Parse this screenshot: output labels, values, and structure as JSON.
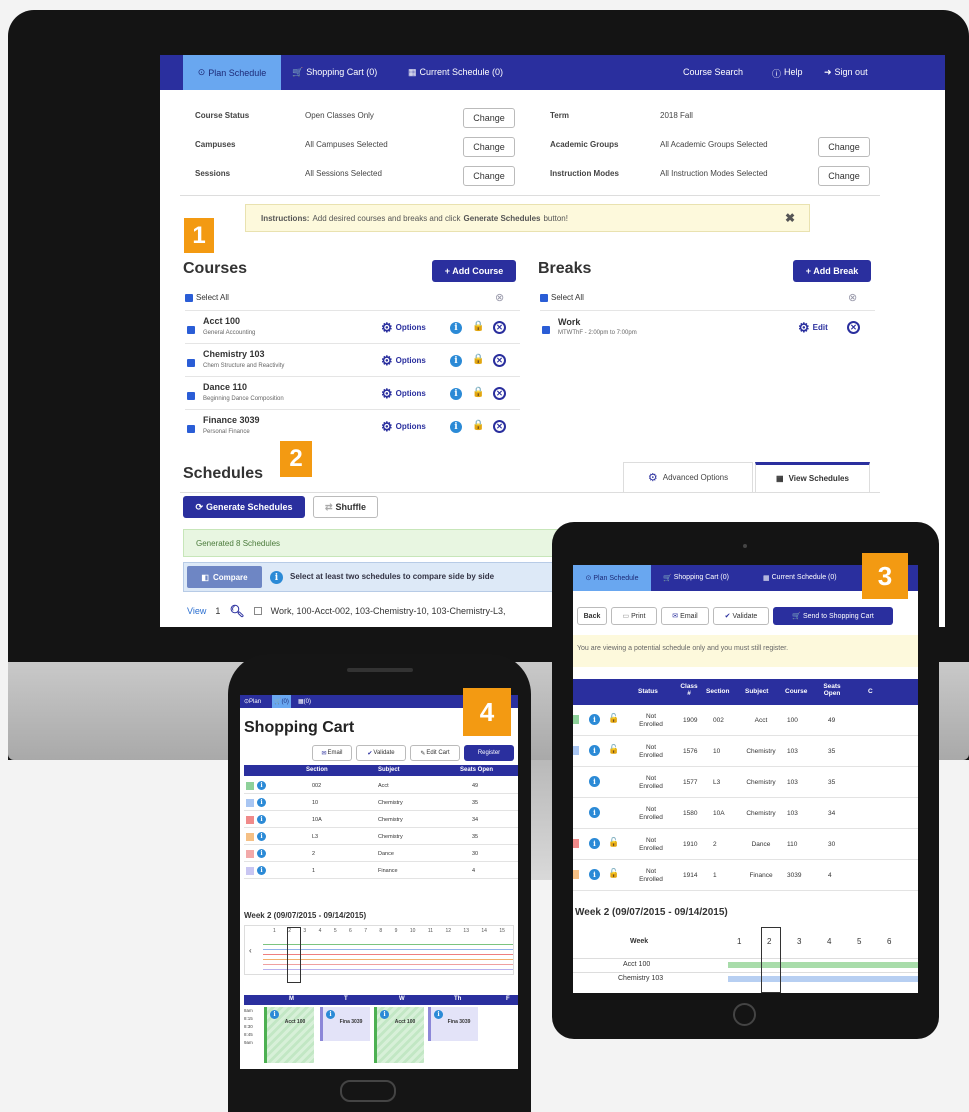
{
  "desktop": {
    "nav": {
      "plan": "Plan Schedule",
      "cart": "Shopping Cart (0)",
      "current": "Current Schedule (0)",
      "search": "Course Search",
      "help": "Help",
      "signout": "Sign out"
    },
    "filters": [
      {
        "label": "Course Status",
        "value": "Open Classes Only",
        "button": "Change"
      },
      {
        "label": "Campuses",
        "value": "All Campuses Selected",
        "button": "Change"
      },
      {
        "label": "Sessions",
        "value": "All Sessions Selected",
        "button": "Change"
      },
      {
        "label": "Term",
        "value": "2018 Fall"
      },
      {
        "label": "Academic Groups",
        "value": "All Academic Groups Selected",
        "button": "Change"
      },
      {
        "label": "Instruction Modes",
        "value": "All Instruction Modes Selected",
        "button": "Change"
      }
    ],
    "instructions": {
      "bold": "Instructions:",
      "text": "Add desired courses and breaks and click",
      "button_ref": "Generate Schedules",
      "tail": "button!"
    },
    "courses": {
      "title": "Courses",
      "add": "+ Add Course",
      "select_all": "Select All",
      "options_label": "Options",
      "items": [
        {
          "name": "Acct 100",
          "desc": "General Accounting"
        },
        {
          "name": "Chemistry 103",
          "desc": "Chem Structure and Reactivity"
        },
        {
          "name": "Dance 110",
          "desc": "Beginning Dance Composition"
        },
        {
          "name": "Finance 3039",
          "desc": "Personal Finance"
        }
      ]
    },
    "breaks": {
      "title": "Breaks",
      "add": "+ Add Break",
      "select_all": "Select All",
      "items": [
        {
          "name": "Work",
          "desc": "MTWThF - 2:00pm to 7:00pm",
          "edit": "Edit"
        }
      ]
    },
    "schedules": {
      "title": "Schedules",
      "advanced": "Advanced Options",
      "view": "View Schedules",
      "generate": "Generate Schedules",
      "shuffle": "Shuffle",
      "generated": "Generated 8 Schedules",
      "compare": "Compare",
      "compare_hint": "Select at least two schedules to compare side by side",
      "view_label": "View",
      "view_num": "1",
      "row_text": "Work, 100-Acct-002, 103-Chemistry-10, 103-Chemistry-L3,"
    }
  },
  "badges": [
    "1",
    "2",
    "3",
    "4"
  ],
  "tablet": {
    "nav": {
      "plan": "Plan Schedule",
      "cart": "Shopping Cart (0)",
      "current": "Current Schedule (0)"
    },
    "buttons": {
      "back": "Back",
      "print": "Print",
      "email": "Email",
      "validate": "Validate",
      "send": "Send to Shopping Cart"
    },
    "notice": "You are viewing a potential schedule only and you must still register.",
    "headers": [
      "Status",
      "Class #",
      "Section",
      "Subject",
      "Course",
      "Seats Open",
      "C"
    ],
    "rows": [
      {
        "status": "Not Enrolled",
        "class": "1909",
        "section": "002",
        "subject": "Acct",
        "course": "100",
        "seats": "49",
        "color": "#8ed19a",
        "lock": true
      },
      {
        "status": "Not Enrolled",
        "class": "1576",
        "section": "10",
        "subject": "Chemistry",
        "course": "103",
        "seats": "35",
        "color": "#a9c6f2",
        "lock": true
      },
      {
        "status": "Not Enrolled",
        "class": "1577",
        "section": "L3",
        "subject": "Chemistry",
        "course": "103",
        "seats": "35",
        "color": "",
        "lock": false
      },
      {
        "status": "Not Enrolled",
        "class": "1580",
        "section": "10A",
        "subject": "Chemistry",
        "course": "103",
        "seats": "34",
        "color": "",
        "lock": false
      },
      {
        "status": "Not Enrolled",
        "class": "1910",
        "section": "2",
        "subject": "Dance",
        "course": "110",
        "seats": "30",
        "color": "#f08a8a",
        "lock": true
      },
      {
        "status": "Not Enrolled",
        "class": "1914",
        "section": "1",
        "subject": "Finance",
        "course": "3039",
        "seats": "4",
        "color": "#f5c085",
        "lock": true
      }
    ],
    "week_title": "Week 2 (09/07/2015 - 09/14/2015)",
    "week_label": "Week",
    "week_nums": [
      "1",
      "2",
      "3",
      "4",
      "5",
      "6"
    ],
    "week_rows": [
      "Acct 100",
      "Chemistry 103"
    ]
  },
  "phone": {
    "nav": {
      "plan": "Plan",
      "cart": "(0)",
      "current": "(0)"
    },
    "title": "Shopping Cart",
    "buttons": {
      "email": "Email",
      "validate": "Validate",
      "edit": "Edit Cart",
      "register": "Register"
    },
    "headers": [
      "Section",
      "Subject",
      "Seats Open"
    ],
    "rows": [
      {
        "section": "002",
        "subject": "Acct",
        "seats": "49",
        "color": "#8ed19a"
      },
      {
        "section": "10",
        "subject": "Chemistry",
        "seats": "35",
        "color": "#a9c6f2"
      },
      {
        "section": "10A",
        "subject": "Chemistry",
        "seats": "34",
        "color": "#f08a8a"
      },
      {
        "section": "L3",
        "subject": "Chemistry",
        "seats": "35",
        "color": "#f5c085"
      },
      {
        "section": "2",
        "subject": "Dance",
        "seats": "30",
        "color": "#f2a9a9"
      },
      {
        "section": "1",
        "subject": "Finance",
        "seats": "4",
        "color": "#c9c6f2"
      }
    ],
    "week_title": "Week 2 (09/07/2015 - 09/14/2015)",
    "week_nums": [
      "1",
      "2",
      "3",
      "4",
      "5",
      "6",
      "7",
      "8",
      "9",
      "10",
      "11",
      "12",
      "13",
      "14",
      "15"
    ],
    "days": [
      "M",
      "T",
      "W",
      "Th",
      "F"
    ],
    "times": [
      "8am",
      "8:15",
      "8:30",
      "8:45",
      "9am"
    ],
    "events": [
      {
        "name": "Acct 100"
      },
      {
        "name": "Fina 3039"
      },
      {
        "name": "Acct 100"
      },
      {
        "name": "Fina 3039"
      }
    ]
  }
}
